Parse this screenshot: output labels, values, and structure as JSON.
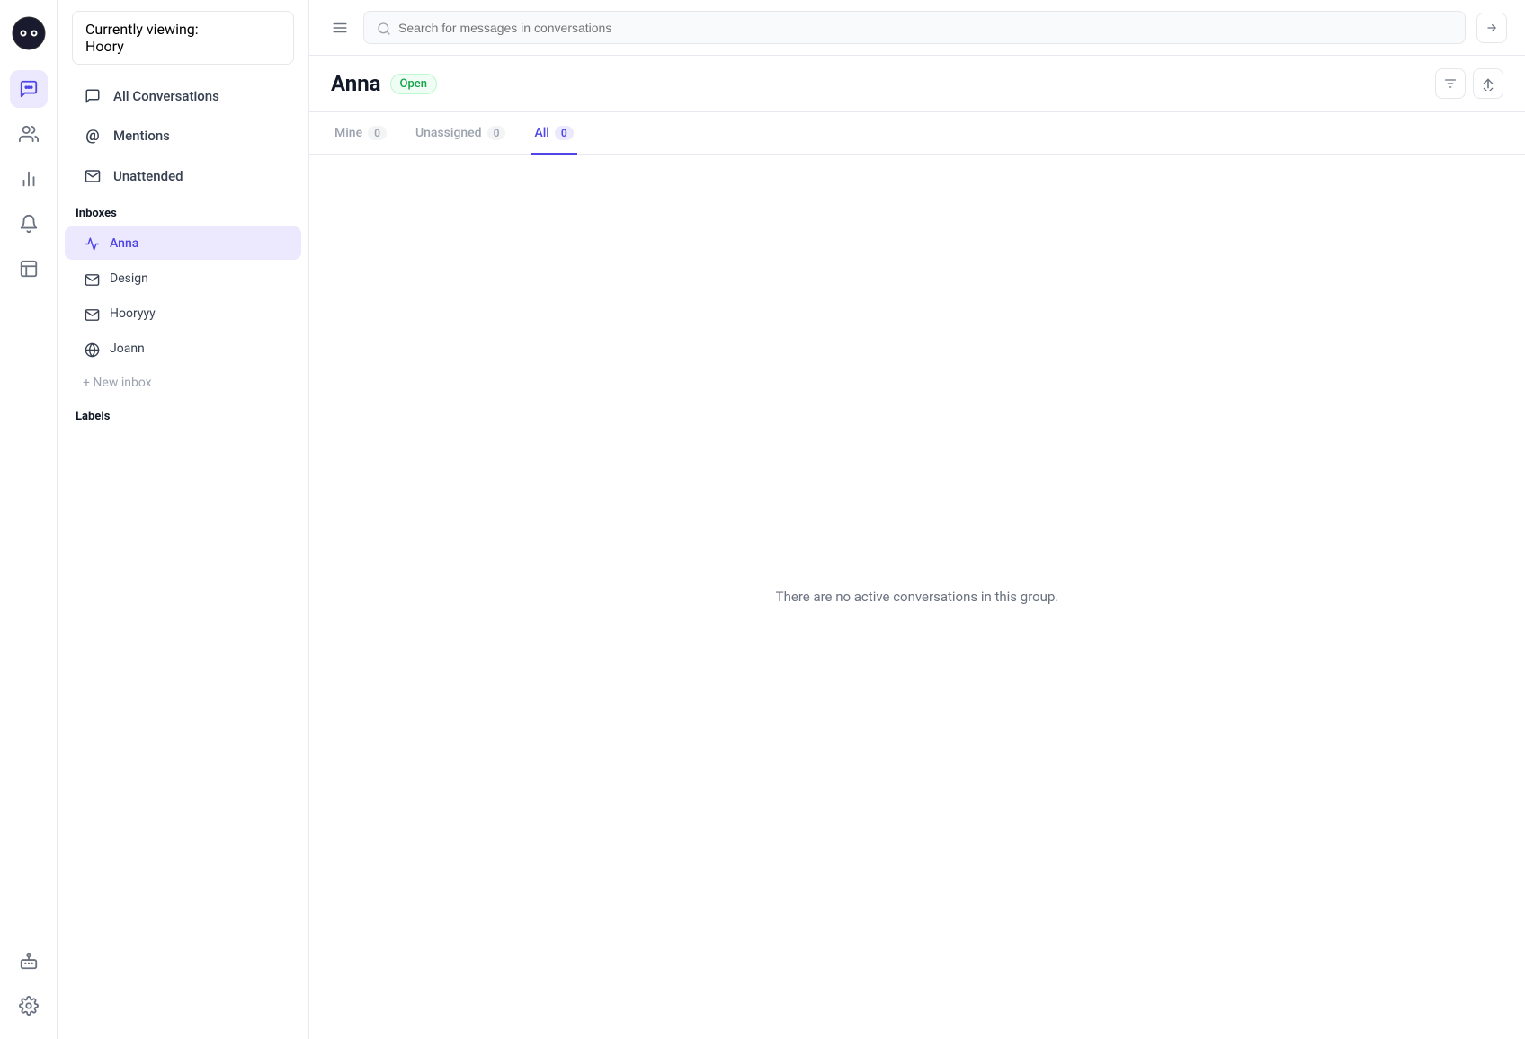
{
  "app": {
    "logo_alt": "Hoory logo"
  },
  "workspace": {
    "currently_viewing_label": "Currently viewing:",
    "name": "Hoory"
  },
  "nav_icons": [
    {
      "name": "conversations-icon",
      "label": "Conversations",
      "active": true
    },
    {
      "name": "contacts-icon",
      "label": "Contacts",
      "active": false
    },
    {
      "name": "reports-icon",
      "label": "Reports",
      "active": false
    },
    {
      "name": "notifications-icon",
      "label": "Notifications",
      "active": false
    },
    {
      "name": "drafts-icon",
      "label": "Drafts",
      "active": false
    },
    {
      "name": "bot-icon",
      "label": "Bot",
      "active": false
    },
    {
      "name": "settings-icon",
      "label": "Settings",
      "active": false
    }
  ],
  "sidebar": {
    "nav_items": [
      {
        "id": "all-conversations",
        "label": "All Conversations",
        "icon": "💬",
        "active": false
      },
      {
        "id": "mentions",
        "label": "Mentions",
        "icon": "@",
        "active": false
      },
      {
        "id": "unattended",
        "label": "Unattended",
        "icon": "✉",
        "active": false
      }
    ],
    "inboxes_section_title": "Inboxes",
    "inboxes": [
      {
        "id": "anna",
        "label": "Anna",
        "icon": "cloud",
        "active": true
      },
      {
        "id": "design",
        "label": "Design",
        "icon": "email",
        "active": false
      },
      {
        "id": "hooryyy",
        "label": "Hooryyy",
        "icon": "email",
        "active": false
      },
      {
        "id": "joann",
        "label": "Joann",
        "icon": "globe",
        "active": false
      }
    ],
    "new_inbox_label": "+ New inbox",
    "labels_section_title": "Labels"
  },
  "topbar": {
    "search_placeholder": "Search for messages in conversations"
  },
  "conversation_view": {
    "title": "Anna",
    "status": "Open",
    "tabs": [
      {
        "id": "mine",
        "label": "Mine",
        "count": "0",
        "active": false
      },
      {
        "id": "unassigned",
        "label": "Unassigned",
        "count": "0",
        "active": false
      },
      {
        "id": "all",
        "label": "All",
        "count": "0",
        "active": true
      }
    ],
    "empty_state_message": "There are no active conversations in this group."
  }
}
